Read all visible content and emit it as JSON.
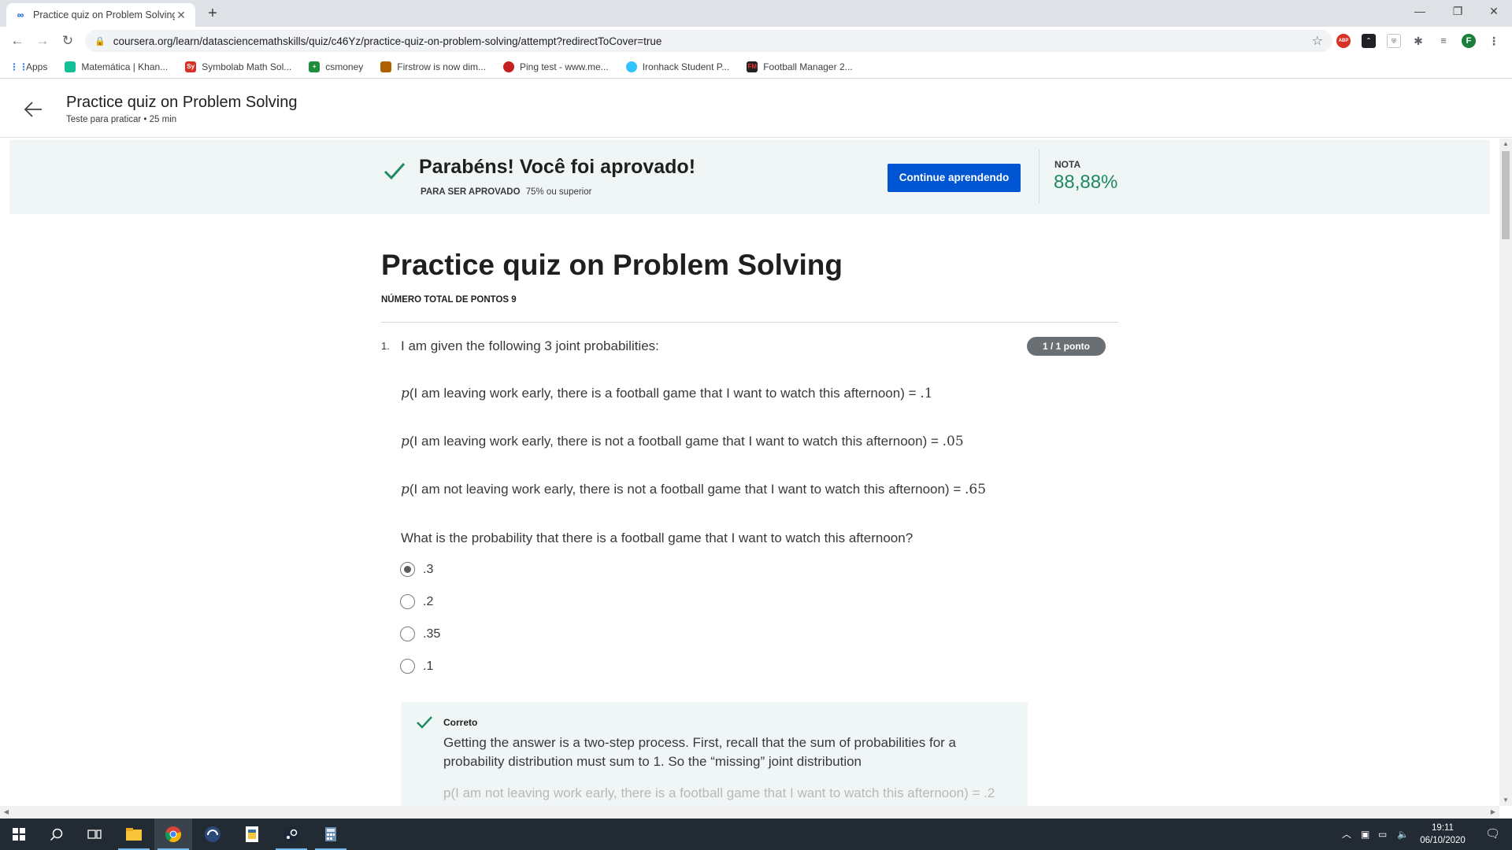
{
  "browser": {
    "tab_title": "Practice quiz on Problem Solving",
    "new_tab": "+",
    "url": "coursera.org/learn/datasciencemathskills/quiz/c46Yz/practice-quiz-on-problem-solving/attempt?redirectToCover=true",
    "profile_initial": "F",
    "ext_abp": "ABP",
    "bookmarks": [
      {
        "label": "Apps",
        "color": "#4285f4",
        "icon": "apps-grid-icon"
      },
      {
        "label": "Matemática | Khan...",
        "color": "#14bf96",
        "icon": "khan-academy-icon"
      },
      {
        "label": "Symbolab Math Sol...",
        "color": "#d93025",
        "icon": "symbolab-icon",
        "glyph": "Sy"
      },
      {
        "label": "csmoney",
        "color": "#1e8e3e",
        "icon": "csmoney-icon",
        "glyph": "+"
      },
      {
        "label": "Firstrow is now dim...",
        "color": "#b06000",
        "icon": "firstrow-icon"
      },
      {
        "label": "Ping test - www.me...",
        "color": "#c5221f",
        "icon": "ping-test-icon"
      },
      {
        "label": "Ironhack Student P...",
        "color": "#32c3ff",
        "icon": "ironhack-icon"
      },
      {
        "label": "Football Manager 2...",
        "color": "#222222",
        "icon": "football-manager-icon",
        "glyph": "FM"
      }
    ]
  },
  "header": {
    "title": "Practice quiz on Problem Solving",
    "subtitle": "Teste para praticar • 25 min"
  },
  "banner": {
    "title": "Parabéns! Você foi aprovado!",
    "pass_label": "PARA SER APROVADO",
    "pass_value": "75% ou superior",
    "continue_button": "Continue aprendendo",
    "grade_label": "NOTA",
    "grade_value": "88,88%",
    "accent": "#1e8a5e",
    "button_color": "#0056d2"
  },
  "quiz": {
    "title": "Practice quiz on Problem Solving",
    "total_points": "NÚMERO TOTAL DE PONTOS 9",
    "question": {
      "number": "1.",
      "intro": "I am given the following 3 joint probabilities:",
      "score_badge": "1 / 1 ponto",
      "probabilities": [
        {
          "prefix": "p",
          "text": "(I am leaving work early, there is a football game that I want to watch this afternoon) = ",
          "value": ".1"
        },
        {
          "prefix": "p",
          "text": "(I am leaving work early, there is not a football game that I want to watch this afternoon) = ",
          "value": ".05"
        },
        {
          "prefix": "p",
          "text": "(I am not leaving work early, there is not a football game that I want to watch this afternoon) = ",
          "value": ".65"
        }
      ],
      "prompt": "What is the probability that there is a football game that I want to watch this afternoon?",
      "options": [
        {
          "label": ".3",
          "selected": true
        },
        {
          "label": ".2",
          "selected": false
        },
        {
          "label": ".35",
          "selected": false
        },
        {
          "label": ".1",
          "selected": false
        }
      ],
      "feedback": {
        "label": "Correto",
        "text": "Getting the answer is a two-step process. First, recall that the sum of probabilities for a probability distribution must sum to 1. So the “missing” joint distribution",
        "cutoff_text": "p(I am not leaving work early, there is a football game that I want to watch this afternoon) = .2"
      }
    }
  },
  "taskbar": {
    "time": "19:11",
    "date": "06/10/2020"
  }
}
